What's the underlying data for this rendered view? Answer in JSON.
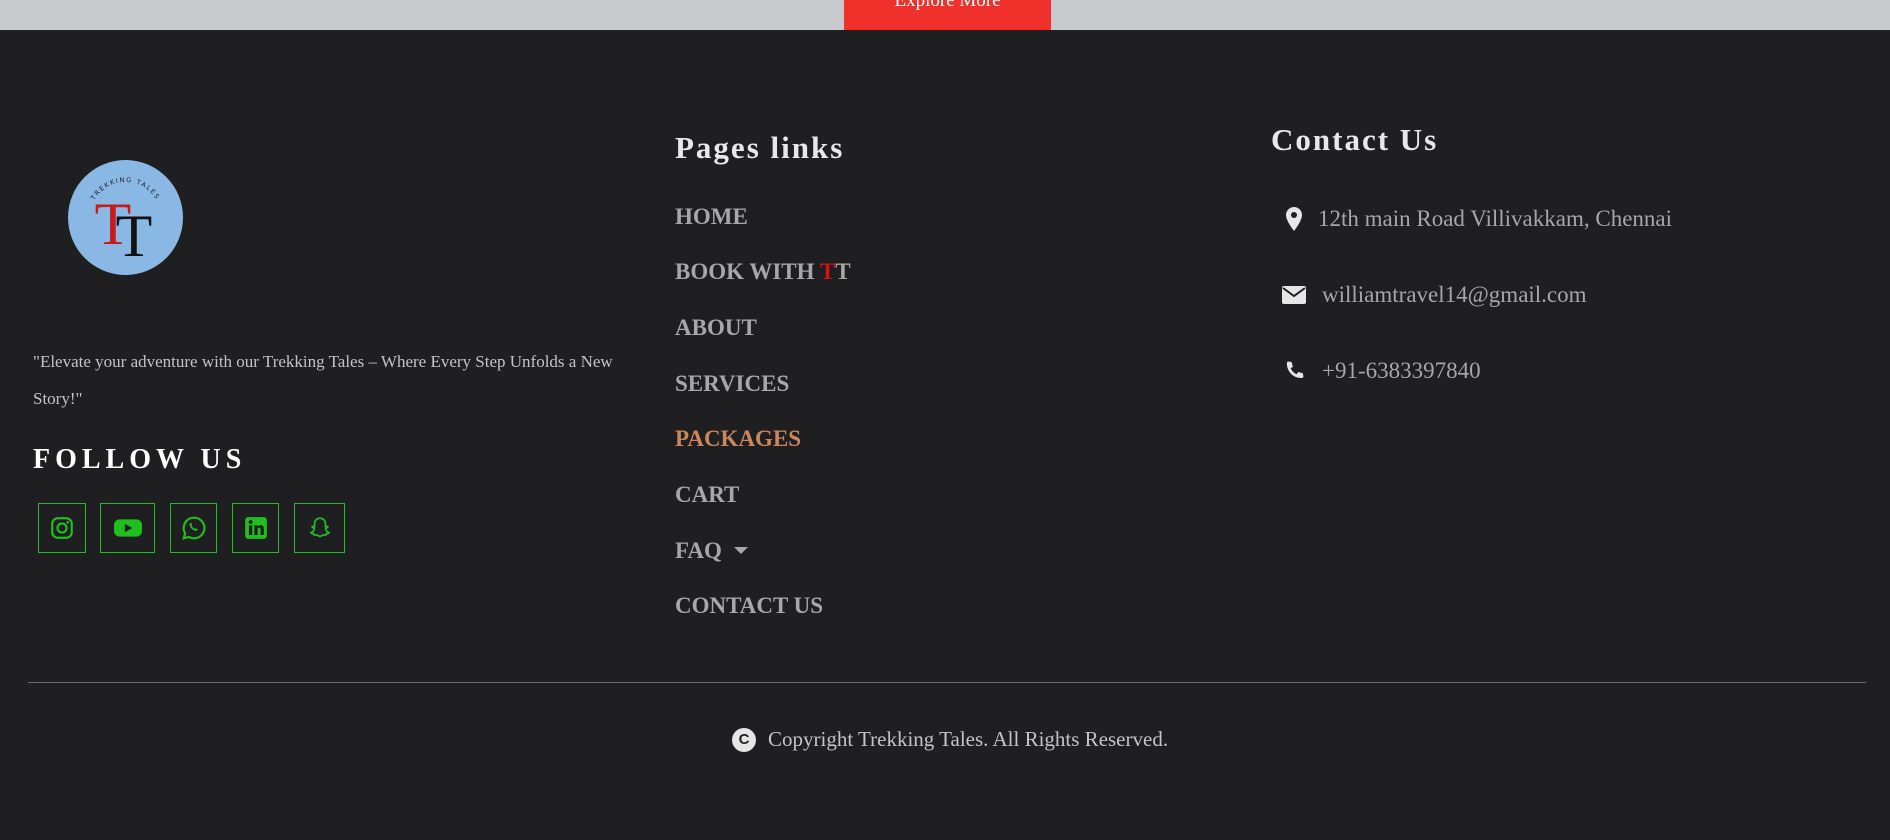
{
  "top": {
    "explore_label": "Explore More"
  },
  "brand": {
    "logo_initials": "TT",
    "logo_ring_text": "TREKKING TALES",
    "tagline": "\"Elevate your adventure with our Trekking Tales – Where Every Step Unfolds a New Story!\""
  },
  "follow": {
    "title": "FOLLOW US",
    "socials": [
      {
        "icon": "instagram-icon"
      },
      {
        "icon": "youtube-icon"
      },
      {
        "icon": "whatsapp-icon"
      },
      {
        "icon": "linkedin-icon"
      },
      {
        "icon": "snapchat-icon"
      }
    ]
  },
  "pages": {
    "title": "Pages links",
    "home": "HOME",
    "book_prefix": "BOOK WITH ",
    "book_red": "T",
    "book_suffix": "T",
    "about": "ABOUT",
    "services": "SERVICES",
    "packages": "PACKAGES",
    "cart": "CART",
    "faq": "FAQ",
    "contact": "CONTACT US"
  },
  "contact": {
    "title": "Contact Us",
    "address": "12th main Road Villivakkam, Chennai",
    "email": "williamtravel14@gmail.com",
    "phone": "+91-6383397840"
  },
  "footer": {
    "copyright_symbol": "C",
    "copyright": "Copyright Trekking Tales. All Rights Reserved."
  },
  "colors": {
    "background": "#1f1e20",
    "accent_red": "#f0302a",
    "social_green": "#1fbf1f",
    "active_link": "#c9875a",
    "logo_blue": "#8ab8e4"
  }
}
